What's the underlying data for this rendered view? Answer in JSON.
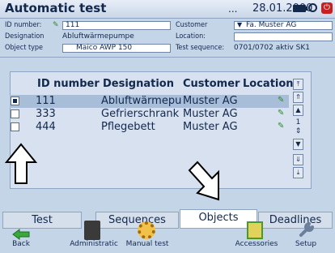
{
  "header": {
    "title": "Automatic test",
    "dots": "...",
    "date": "28.01.2000",
    "battery_icon": "battery-icon",
    "clock_icon": "clock-icon",
    "power_icon": "power-icon"
  },
  "info": {
    "id_label": "ID number:",
    "id_value": "111",
    "designation_label": "Designation",
    "designation_value": "Abluftwärmepumpe",
    "object_type_label": "Object type",
    "object_type_value": "Maico AWP 150",
    "customer_label": "Customer",
    "customer_value": "Fa. Muster AG",
    "location_label": "Location:",
    "location_value": "",
    "test_sequence_label": "Test sequence:",
    "test_sequence_value": "0701/0702 aktiv SK1"
  },
  "list": {
    "columns": [
      "ID number",
      "Designation",
      "Customer",
      "Location"
    ],
    "rows": [
      {
        "id": "111",
        "designation": "Abluftwärmepu",
        "customer": "Muster AG",
        "location": "",
        "checked": true,
        "selected": true
      },
      {
        "id": "333",
        "designation": "Gefrierschrank",
        "customer": "Muster AG",
        "location": "",
        "checked": false,
        "selected": false
      },
      {
        "id": "444",
        "designation": "Pflegebett",
        "customer": "Muster AG",
        "location": "",
        "checked": false,
        "selected": false
      }
    ],
    "page_number": "1"
  },
  "tabs": [
    {
      "label": "Test"
    },
    {
      "label": "Sequences"
    },
    {
      "label": "Objects",
      "active": true
    },
    {
      "label": "Deadlines"
    }
  ],
  "toolbar": {
    "back": "Back",
    "administration": "Administratic",
    "manual_test": "Manual test",
    "accessories": "Accessories",
    "setup": "Setup"
  },
  "colors": {
    "background": "#c5d5e8",
    "selected_row": "#a8bdd8",
    "text": "#12284d"
  }
}
